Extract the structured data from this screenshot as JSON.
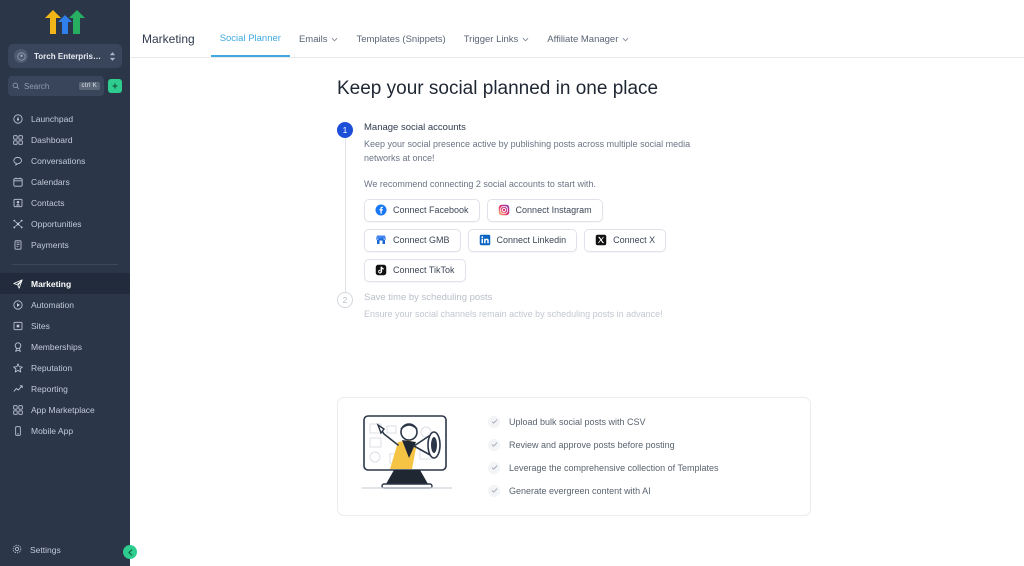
{
  "sidebar": {
    "logo": "three-arrows-logo",
    "logo_colors": [
      "#f2b517",
      "#2f80ed",
      "#27ae60"
    ],
    "workspace": {
      "name": "Torch Enterprise LLC",
      "avatar_icon": "workspace-avatar-icon",
      "switcher_icon": "up-down-chevrons-icon"
    },
    "search": {
      "placeholder": "Search",
      "icon": "search-icon",
      "shortcut": "ctrl K",
      "spark_icon": "sparkle-icon"
    },
    "groups": [
      {
        "items": [
          {
            "label": "Launchpad",
            "icon": "rocket-icon"
          },
          {
            "label": "Dashboard",
            "icon": "grid-icon"
          },
          {
            "label": "Conversations",
            "icon": "chat-bubble-icon"
          },
          {
            "label": "Calendars",
            "icon": "calendar-icon"
          },
          {
            "label": "Contacts",
            "icon": "contact-card-icon"
          },
          {
            "label": "Opportunities",
            "icon": "opportunities-icon"
          },
          {
            "label": "Payments",
            "icon": "payments-icon"
          }
        ]
      },
      {
        "items": [
          {
            "label": "Marketing",
            "icon": "paper-plane-icon",
            "active": true
          },
          {
            "label": "Automation",
            "icon": "play-circle-icon"
          },
          {
            "label": "Sites",
            "icon": "sites-icon"
          },
          {
            "label": "Memberships",
            "icon": "badge-icon"
          },
          {
            "label": "Reputation",
            "icon": "star-icon"
          },
          {
            "label": "Reporting",
            "icon": "trending-up-icon"
          },
          {
            "label": "App Marketplace",
            "icon": "apps-grid-icon"
          },
          {
            "label": "Mobile App",
            "icon": "mobile-phone-icon"
          }
        ]
      }
    ],
    "settings": {
      "label": "Settings",
      "icon": "gear-icon"
    },
    "collapse": {
      "icon": "chevron-left-icon",
      "color": "#2ecc8f"
    }
  },
  "topbar": {
    "title": "Marketing",
    "tabs": [
      {
        "label": "Social Planner",
        "active": true,
        "caret": ""
      },
      {
        "label": "Emails",
        "active": false,
        "caret": "⌄"
      },
      {
        "label": "Templates (Snippets)",
        "active": false,
        "caret": ""
      },
      {
        "label": "Trigger Links",
        "active": false,
        "caret": "⌄"
      },
      {
        "label": "Affiliate Manager",
        "active": false,
        "caret": "⌄"
      }
    ],
    "accent_color": "#3fa9e0"
  },
  "main": {
    "hero_title": "Keep your social planned in one place",
    "steps": [
      {
        "number": "1",
        "state": "active",
        "title": "Manage social accounts",
        "description": "Keep your social presence active by publishing posts across multiple social media networks at once!",
        "note": "We recommend connecting 2 social accounts to start with.",
        "button_rows": [
          [
            {
              "label": "Connect Facebook",
              "icon": "facebook-icon"
            },
            {
              "label": "Connect Instagram",
              "icon": "instagram-icon"
            }
          ],
          [
            {
              "label": "Connect GMB",
              "icon": "google-my-business-icon"
            },
            {
              "label": "Connect Linkedin",
              "icon": "linkedin-icon"
            },
            {
              "label": "Connect X",
              "icon": "x-twitter-icon"
            }
          ],
          [
            {
              "label": "Connect TikTok",
              "icon": "tiktok-icon"
            }
          ]
        ]
      },
      {
        "number": "2",
        "state": "inactive",
        "title": "Save time by scheduling posts",
        "description": "Ensure your social channels remain active by scheduling posts in advance!"
      }
    ],
    "feature_card": {
      "illustration": "person-with-megaphone-in-monitor-illustration",
      "items": [
        {
          "label": "Upload bulk social posts with CSV",
          "icon": "check-icon"
        },
        {
          "label": "Review and approve posts before posting",
          "icon": "check-icon"
        },
        {
          "label": "Leverage the comprehensive collection of Templates",
          "icon": "check-icon"
        },
        {
          "label": "Generate evergreen content with AI",
          "icon": "check-icon"
        }
      ]
    }
  }
}
